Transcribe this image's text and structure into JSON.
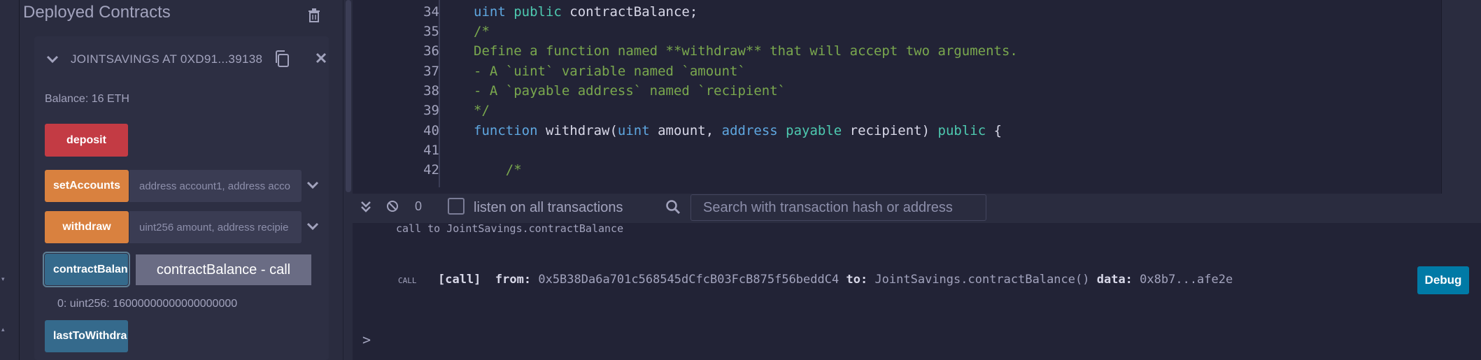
{
  "deployed": {
    "title": "Deployed Contracts",
    "instance_name": "JOINTSAVINGS AT 0XD91...39138",
    "balance": "Balance: 16 ETH",
    "functions": {
      "deposit": "deposit",
      "setAccounts": "setAccounts",
      "setAccounts_placeholder": "address account1, address acco",
      "withdraw": "withdraw",
      "withdraw_placeholder": "uint256 amount, address recipie",
      "contractBalance": "contractBalanc",
      "lastToWithdraw": "lastToWithdra"
    },
    "tooltip": "contractBalance - call",
    "result": "0: uint256: 16000000000000000000"
  },
  "editor": {
    "lines": [
      {
        "n": "34",
        "parts": [
          [
            "kw",
            "uint "
          ],
          [
            "kw2",
            "public "
          ],
          [
            "tx",
            "contractBalance;"
          ]
        ]
      },
      {
        "n": "35",
        "parts": [
          [
            "cm",
            "/*"
          ]
        ]
      },
      {
        "n": "36",
        "parts": [
          [
            "cm",
            "Define a function named **withdraw** that will accept two arguments."
          ]
        ]
      },
      {
        "n": "37",
        "parts": [
          [
            "cm",
            "- A `uint` variable named `amount`"
          ]
        ]
      },
      {
        "n": "38",
        "parts": [
          [
            "cm",
            "- A `payable address` named `recipient`"
          ]
        ]
      },
      {
        "n": "39",
        "parts": [
          [
            "cm",
            "*/"
          ]
        ]
      },
      {
        "n": "40",
        "parts": [
          [
            "kw",
            "function "
          ],
          [
            "tx",
            "withdraw("
          ],
          [
            "kw",
            "uint "
          ],
          [
            "tx",
            "amount, "
          ],
          [
            "kw",
            "address "
          ],
          [
            "kw2",
            "payable "
          ],
          [
            "tx",
            "recipient) "
          ],
          [
            "kw2",
            "public "
          ],
          [
            "tx",
            "{"
          ]
        ]
      },
      {
        "n": "41",
        "parts": []
      },
      {
        "n": "42",
        "parts": [
          [
            "cm",
            "    /*"
          ]
        ]
      }
    ]
  },
  "terminal": {
    "count": "0",
    "listen_label": "listen on all transactions",
    "search_placeholder": "Search with transaction hash or address",
    "cut_line": "call to JointSavings.contractBalance",
    "call_tag": "CALL",
    "call_type": "[call]",
    "from_label": "from:",
    "from_value": "0x5B38Da6a701c568545dCfcB03FcB875f56beddC4",
    "to_label": "to:",
    "to_value": "JointSavings.contractBalance()",
    "data_label": "data:",
    "data_value": "0x8b7...afe2e",
    "debug_label": "Debug",
    "prompt": ">"
  }
}
